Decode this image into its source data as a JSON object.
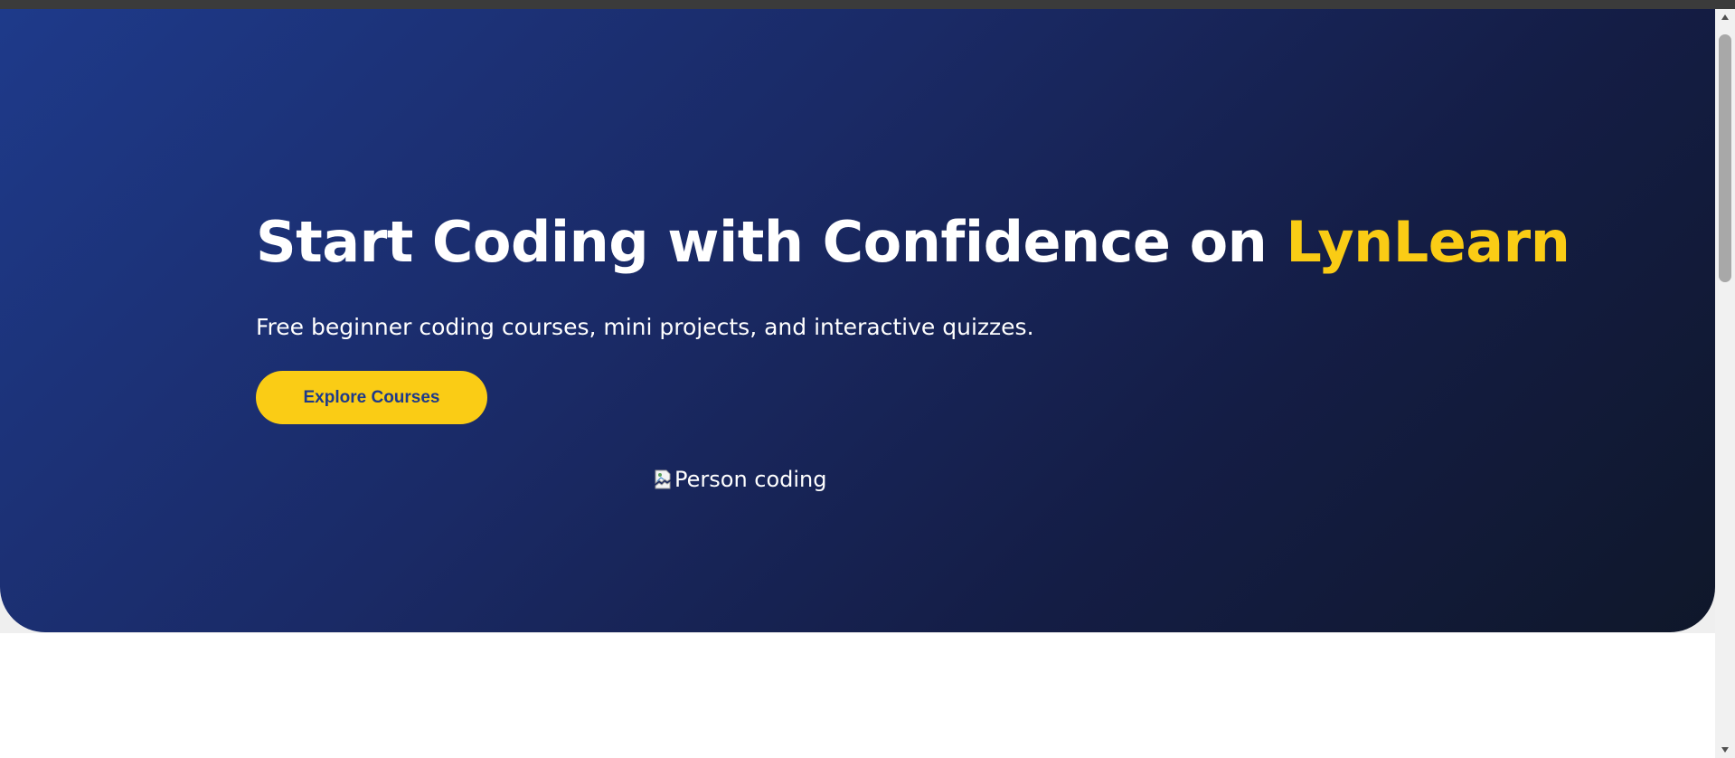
{
  "hero": {
    "title_main": "Start Coding with Confidence on ",
    "title_brand": "LynLearn",
    "subtitle": "Free beginner coding courses, mini projects, and interactive quizzes.",
    "cta_label": "Explore Courses",
    "image_alt": "Person coding"
  },
  "colors": {
    "brand_yellow": "#facc15",
    "hero_gradient_start": "#1e3a8a",
    "hero_gradient_end": "#0f172a",
    "button_text": "#1e3a8a"
  },
  "icons": {
    "broken_image": "broken-image-icon",
    "scroll_up": "triangle-up-icon",
    "scroll_down": "triangle-down-icon"
  }
}
